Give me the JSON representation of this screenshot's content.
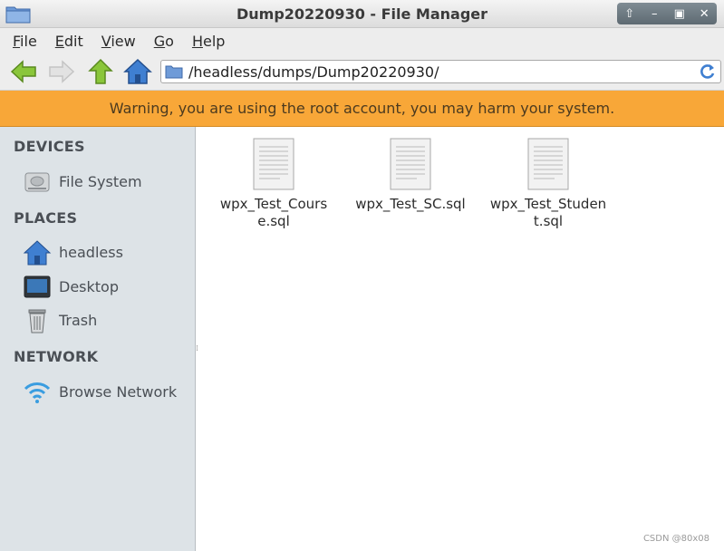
{
  "window": {
    "title": "Dump20220930 - File Manager",
    "controls": {
      "restore": "⇧",
      "minimize": "–",
      "maximize": "▣",
      "close": "✕"
    }
  },
  "menu": {
    "items": [
      {
        "first": "F",
        "rest": "ile"
      },
      {
        "first": "E",
        "rest": "dit"
      },
      {
        "first": "V",
        "rest": "iew"
      },
      {
        "first": "G",
        "rest": "o"
      },
      {
        "first": "H",
        "rest": "elp"
      }
    ]
  },
  "toolbar": {
    "location_path": "/headless/dumps/Dump20220930/",
    "icons": [
      "back-icon",
      "forward-icon",
      "up-icon",
      "home-icon",
      "folder-icon",
      "reload-icon"
    ]
  },
  "warning": {
    "text": "Warning, you are using the root account, you may harm your system."
  },
  "sidebar": {
    "devices_heading": "DEVICES",
    "devices": [
      {
        "label": "File System",
        "icon": "drive-icon"
      }
    ],
    "places_heading": "PLACES",
    "places": [
      {
        "label": "headless",
        "icon": "home-icon"
      },
      {
        "label": "Desktop",
        "icon": "desktop-icon"
      },
      {
        "label": "Trash",
        "icon": "trash-icon"
      }
    ],
    "network_heading": "NETWORK",
    "network": [
      {
        "label": "Browse Network",
        "icon": "wifi-icon"
      }
    ]
  },
  "files": [
    {
      "line1": "wpx_Test_Cours",
      "line2": "e.sql"
    },
    {
      "line1": "wpx_Test_SC.sql",
      "line2": ""
    },
    {
      "line1": "wpx_Test_Studen",
      "line2": "t.sql"
    }
  ],
  "watermark": "CSDN @80x08",
  "colors": {
    "warning_bg": "#f8a738",
    "sidebar_bg": "#dde3e7",
    "accent_blue": "#3f7fd1",
    "arrow_green": "#8ac63a"
  }
}
